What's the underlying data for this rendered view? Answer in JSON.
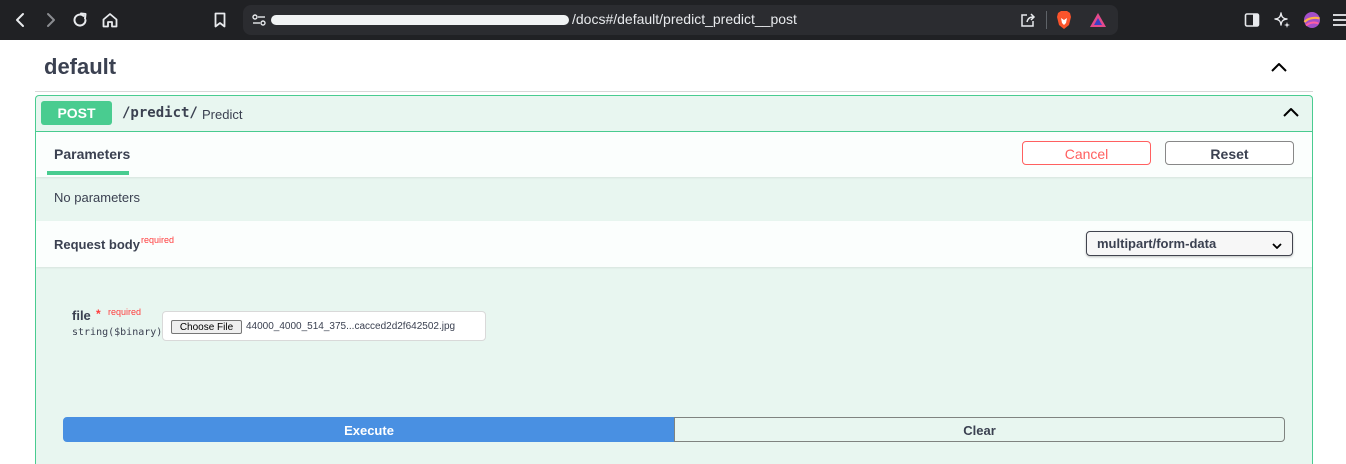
{
  "browser": {
    "url_visible": "/docs#/default/predict_predict__post",
    "icons": [
      "back-icon",
      "forward-icon",
      "reload-icon",
      "home-icon",
      "bookmark-icon",
      "site-settings-icon",
      "share-icon",
      "brave-shields-icon",
      "brave-rewards-icon",
      "sidebar-icon",
      "leo-ai-icon",
      "profile-icon",
      "menu-icon"
    ]
  },
  "tag": {
    "title": "default"
  },
  "operation": {
    "method": "POST",
    "path": "/predict/",
    "summary": "Predict",
    "tab_parameters": "Parameters",
    "cancel_label": "Cancel",
    "reset_label": "Reset",
    "no_parameters": "No parameters",
    "request_body_label": "Request body",
    "required_label": "required",
    "content_type": "multipart/form-data",
    "field": {
      "name": "file",
      "star": "*",
      "required": "required",
      "type": "string($binary)",
      "choose_label": "Choose File",
      "file_name": "44000_4000_514_375...cacced2d2f642502.jpg"
    },
    "execute_label": "Execute",
    "clear_label": "Clear"
  },
  "colors": {
    "post_green": "#49cc90",
    "execute_blue": "#4990e2",
    "cancel_red": "#ff6060",
    "text": "#3b4151"
  }
}
